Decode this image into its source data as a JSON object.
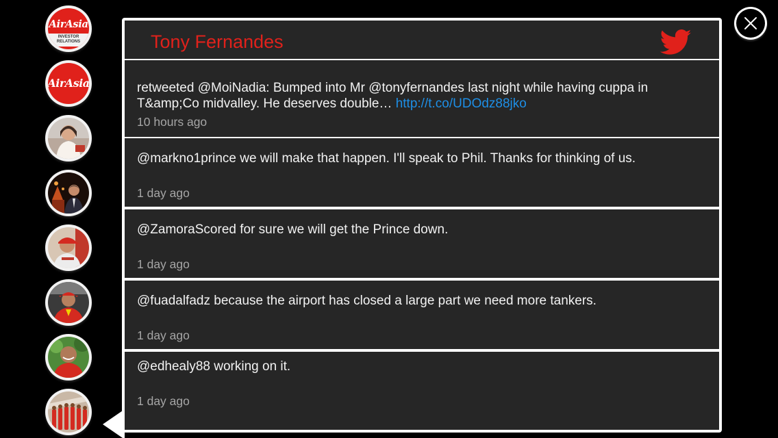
{
  "panel": {
    "title": "Tony Fernandes",
    "social_icon": "twitter-bird-icon"
  },
  "avatars": [
    {
      "name": "airasia-investor-relations",
      "kind": "logo",
      "script": "AirAsia",
      "sub": "INVESTOR RELATIONS"
    },
    {
      "name": "airasia",
      "kind": "logo",
      "script": "AirAsia"
    },
    {
      "name": "profile-woman",
      "kind": "photo"
    },
    {
      "name": "profile-man-night",
      "kind": "photo"
    },
    {
      "name": "profile-man-red-cap",
      "kind": "photo"
    },
    {
      "name": "profile-man-red-shirt",
      "kind": "photo"
    },
    {
      "name": "profile-man-smiling",
      "kind": "photo"
    },
    {
      "name": "profile-crew-group",
      "kind": "photo",
      "selected": true
    }
  ],
  "tweets": [
    {
      "text": "retweeted @MoiNadia: Bumped into Mr @tonyfernandes last night while having cuppa in T&amp;Co midvalley. He deserves double… ",
      "link": "http://t.co/UDOdz88jko",
      "time": "10 hours ago"
    },
    {
      "text": "@markno1prince we will make that happen. I'll speak to Phil. Thanks for thinking of us.",
      "time": "1 day ago"
    },
    {
      "text": "@ZamoraScored for sure we will get the Prince down.",
      "time": "1 day ago"
    },
    {
      "text": "@fuadalfadz because the airport has closed a large part we need more tankers.",
      "time": "1 day ago"
    },
    {
      "text": "@edhealy88 working on it.",
      "time": "1 day ago"
    }
  ],
  "close": {
    "icon": "close-icon"
  },
  "colors": {
    "accent": "#e0211b",
    "link": "#1e8fe6",
    "panel_bg": "#262626",
    "timestamp": "#a6a6a6"
  }
}
